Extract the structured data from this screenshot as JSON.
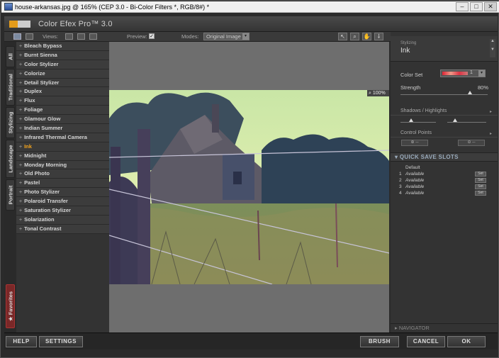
{
  "window": {
    "title": "house-arkansas.jpg @ 165% (CEP 3.0 - Bi-Color Filters *, RGB/8#) *",
    "minimize": "‒",
    "maximize": "□",
    "close": "✕"
  },
  "app": {
    "title": "Color Efex Pro™ 3.0"
  },
  "toolbar": {
    "views_label": "Views:",
    "preview_label": "Preview:",
    "preview_checked": "✓",
    "modes_label": "Modes:",
    "mode_value": "Original Image",
    "mode_arrow": "▾"
  },
  "left_tabs": [
    "All",
    "Traditional",
    "Stylizing",
    "Landscape",
    "Portrait"
  ],
  "favorites_tab": "★ Favorites",
  "filters": [
    "Bleach Bypass",
    "Burnt Sienna",
    "Color Stylizer",
    "Colorize",
    "Detail Stylizer",
    "Duplex",
    "Flux",
    "Foliage",
    "Glamour Glow",
    "Indian Summer",
    "Infrared Thermal Camera",
    "Ink",
    "Midnight",
    "Monday Morning",
    "Old Photo",
    "Pastel",
    "Photo Stylizer",
    "Polaroid Transfer",
    "Saturation Stylizer",
    "Solarization",
    "Tonal Contrast"
  ],
  "selected_filter": "Ink",
  "preview": {
    "zoom": "100%"
  },
  "right_panel": {
    "category": "Stylizing",
    "filter_name": "Ink",
    "color_set_label": "Color Set",
    "color_set_value": "1",
    "strength_label": "Strength",
    "strength_value": "80%",
    "strength_level": 0.8,
    "shadows_label": "Shadows / Highlights",
    "control_points_label": "Control Points",
    "quick_save_label": "QUICK SAVE SLOTS",
    "default_label": "Default",
    "slots": [
      {
        "num": "1",
        "label": "Available",
        "btn": "Set"
      },
      {
        "num": "2",
        "label": "Available",
        "btn": "Set"
      },
      {
        "num": "3",
        "label": "Available",
        "btn": "Set"
      },
      {
        "num": "4",
        "label": "Available",
        "btn": "Set"
      }
    ],
    "navigator_label": "NAVIGATOR"
  },
  "buttons": {
    "help": "HELP",
    "settings": "SETTINGS",
    "brush": "BRUSH",
    "cancel": "CANCEL",
    "ok": "OK"
  },
  "colors": {
    "accent": "#f1a21d",
    "panel": "#333333",
    "canvas_bg": "#6e6e6e"
  }
}
